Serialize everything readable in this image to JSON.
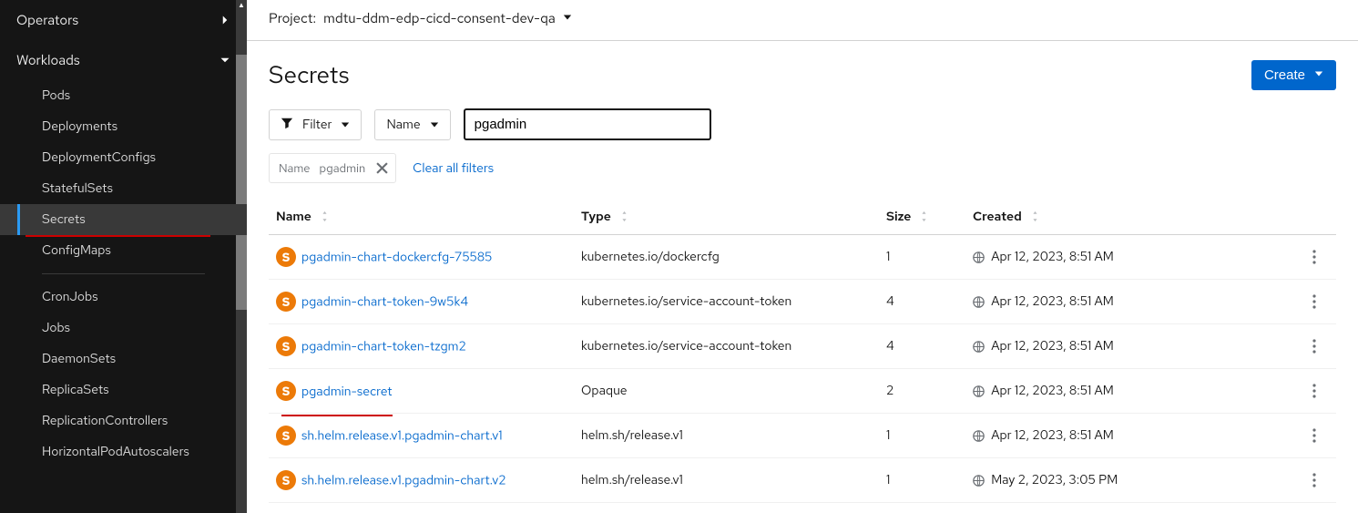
{
  "sidebar": {
    "sections": [
      {
        "label": "Operators",
        "expanded": false
      },
      {
        "label": "Workloads",
        "expanded": true
      }
    ],
    "workloads_items": [
      {
        "label": "Pods"
      },
      {
        "label": "Deployments"
      },
      {
        "label": "DeploymentConfigs"
      },
      {
        "label": "StatefulSets"
      },
      {
        "label": "Secrets",
        "active": true,
        "annot_underline": true
      },
      {
        "label": "ConfigMaps"
      }
    ],
    "workloads_items2": [
      {
        "label": "CronJobs"
      },
      {
        "label": "Jobs"
      },
      {
        "label": "DaemonSets"
      },
      {
        "label": "ReplicaSets"
      },
      {
        "label": "ReplicationControllers"
      },
      {
        "label": "HorizontalPodAutoscalers"
      }
    ]
  },
  "topbar": {
    "prefix": "Project:",
    "project": "mdtu-ddm-edp-cicd-consent-dev-qa"
  },
  "page": {
    "title": "Secrets",
    "create_label": "Create"
  },
  "toolbar": {
    "filter_label": "Filter",
    "search_type": "Name",
    "search_value": "pgadmin"
  },
  "chips": {
    "label": "Name",
    "value": "pgadmin",
    "clear_all": "Clear all filters"
  },
  "table": {
    "columns": {
      "name": "Name",
      "type": "Type",
      "size": "Size",
      "created": "Created"
    },
    "badge_letter": "S",
    "rows": [
      {
        "name": "pgadmin-chart-dockercfg-75585",
        "type": "kubernetes.io/dockercfg",
        "size": "1",
        "created": "Apr 12, 2023, 8:51 AM"
      },
      {
        "name": "pgadmin-chart-token-9w5k4",
        "type": "kubernetes.io/service-account-token",
        "size": "4",
        "created": "Apr 12, 2023, 8:51 AM"
      },
      {
        "name": "pgadmin-chart-token-tzgm2",
        "type": "kubernetes.io/service-account-token",
        "size": "4",
        "created": "Apr 12, 2023, 8:51 AM"
      },
      {
        "name": "pgadmin-secret",
        "type": "Opaque",
        "size": "2",
        "created": "Apr 12, 2023, 8:51 AM",
        "annot_underline": true
      },
      {
        "name": "sh.helm.release.v1.pgadmin-chart.v1",
        "type": "helm.sh/release.v1",
        "size": "1",
        "created": "Apr 12, 2023, 8:51 AM"
      },
      {
        "name": "sh.helm.release.v1.pgadmin-chart.v2",
        "type": "helm.sh/release.v1",
        "size": "1",
        "created": "May 2, 2023, 3:05 PM"
      }
    ]
  }
}
